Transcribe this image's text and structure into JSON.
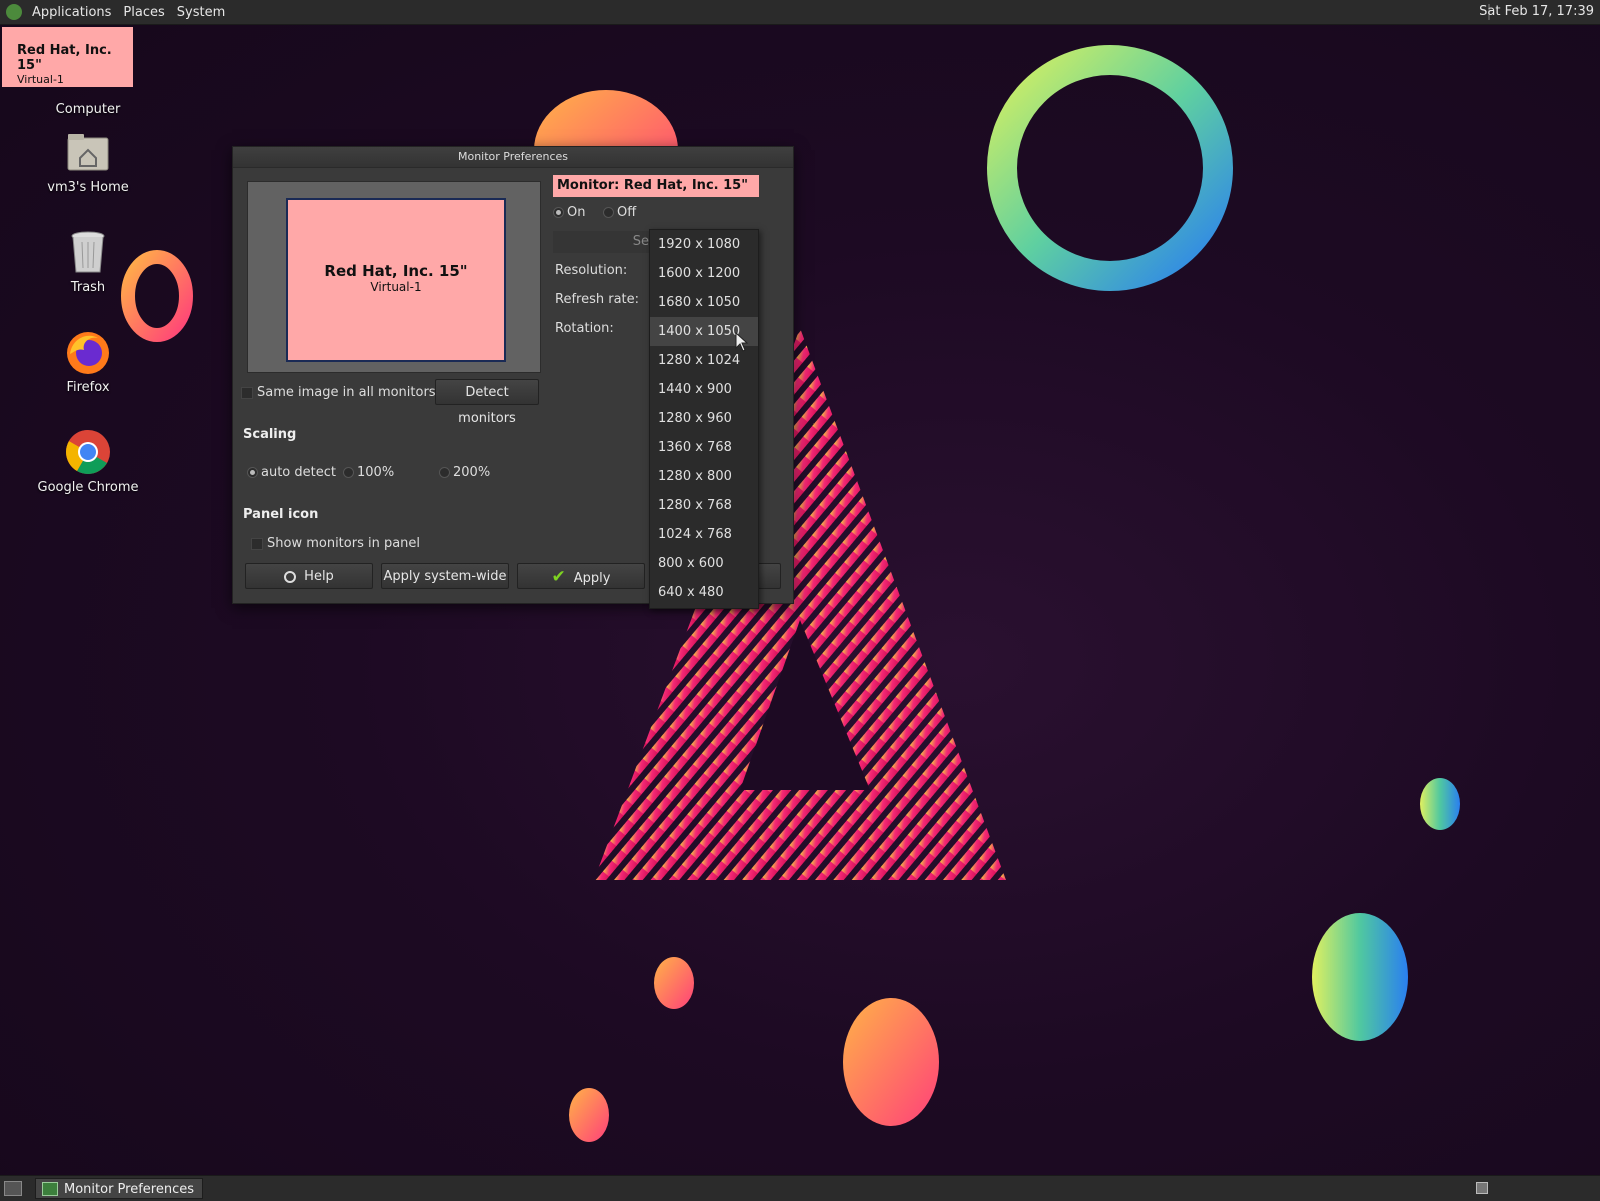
{
  "top_panel": {
    "menus": [
      "Applications",
      "Places",
      "System"
    ],
    "clock": "Sat Feb 17, 17:39"
  },
  "osd": {
    "title": "Red Hat, Inc. 15\"",
    "subtitle": "Virtual-1"
  },
  "desktop_icons": [
    {
      "label": "Computer",
      "icon": "computer-icon"
    },
    {
      "label": "vm3's Home",
      "icon": "home-folder-icon"
    },
    {
      "label": "Trash",
      "icon": "trash-icon"
    },
    {
      "label": "Firefox",
      "icon": "firefox-icon"
    },
    {
      "label": "Google Chrome",
      "icon": "chrome-icon"
    }
  ],
  "dialog": {
    "title": "Monitor Preferences",
    "preview": {
      "name": "Red Hat, Inc. 15\"",
      "connector": "Virtual-1"
    },
    "monitor_label": "Monitor: Red Hat, Inc. 15\"",
    "power": {
      "on_label": "On",
      "off_label": "Off",
      "selected": "On"
    },
    "set_as_label": "Set as",
    "resolution_label": "Resolution:",
    "refresh_label": "Refresh rate:",
    "rotation_label": "Rotation:",
    "same_image_label": "Same image in all monitors",
    "detect_button": "Detect monitors",
    "scaling": {
      "heading": "Scaling",
      "options": [
        "auto detect",
        "100%",
        "200%"
      ],
      "selected": "auto detect"
    },
    "panel_icon": {
      "heading": "Panel icon",
      "show_label": "Show monitors in panel"
    },
    "buttons": {
      "help": "Help",
      "apply_system_wide": "Apply system-wide",
      "apply": "Apply"
    }
  },
  "resolution_dropdown": {
    "options": [
      "1920 x 1080",
      "1600 x 1200",
      "1680 x 1050",
      "1400 x 1050",
      "1280 x 1024",
      "1440 x 900",
      "1280 x 960",
      "1360 x 768",
      "1280 x 800",
      "1280 x 768",
      "1024 x 768",
      "800 x 600",
      "640 x 480"
    ],
    "highlighted": "1400 x 1050"
  },
  "bottom_panel": {
    "task": "Monitor Preferences"
  },
  "colors": {
    "accent_pink": "#ffa8a8",
    "panel": "#2b2b2b"
  }
}
